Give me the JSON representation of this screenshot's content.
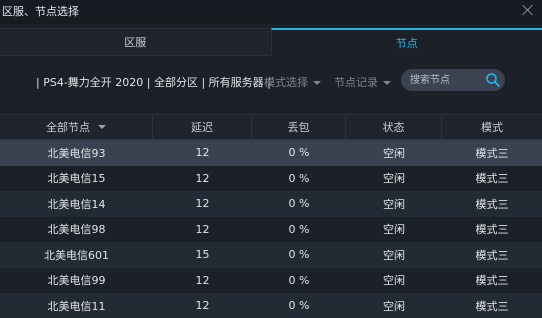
{
  "window": {
    "title": "区服、节点选择"
  },
  "tabs": [
    {
      "label": "区服",
      "active": false
    },
    {
      "label": "节点",
      "active": true
    }
  ],
  "toolbar": {
    "server_info": "| PS4-舞力全开 2020 | 全部分区 | 所有服务器 |",
    "mode_select": "模式选择",
    "node_record": "节点记录",
    "search_placeholder": "搜索节点"
  },
  "table": {
    "headers": [
      "全部节点",
      "延迟",
      "丢包",
      "状态",
      "模式"
    ],
    "rows": [
      {
        "node": "北美电信93",
        "latency": "12",
        "loss": "0 %",
        "status": "空闲",
        "mode": "模式三",
        "selected": true
      },
      {
        "node": "北美电信15",
        "latency": "12",
        "loss": "0 %",
        "status": "空闲",
        "mode": "模式三"
      },
      {
        "node": "北美电信14",
        "latency": "12",
        "loss": "0 %",
        "status": "空闲",
        "mode": "模式三"
      },
      {
        "node": "北美电信98",
        "latency": "12",
        "loss": "0 %",
        "status": "空闲",
        "mode": "模式三"
      },
      {
        "node": "北美电信601",
        "latency": "15",
        "loss": "0 %",
        "status": "空闲",
        "mode": "模式三"
      },
      {
        "node": "北美电信99",
        "latency": "12",
        "loss": "0 %",
        "status": "空闲",
        "mode": "模式三"
      },
      {
        "node": "北美电信11",
        "latency": "12",
        "loss": "0 %",
        "status": "空闲",
        "mode": "模式三"
      }
    ]
  },
  "colors": {
    "accent": "#24b0e8",
    "background": "#1c2129",
    "selected_row": "#3a4252"
  }
}
